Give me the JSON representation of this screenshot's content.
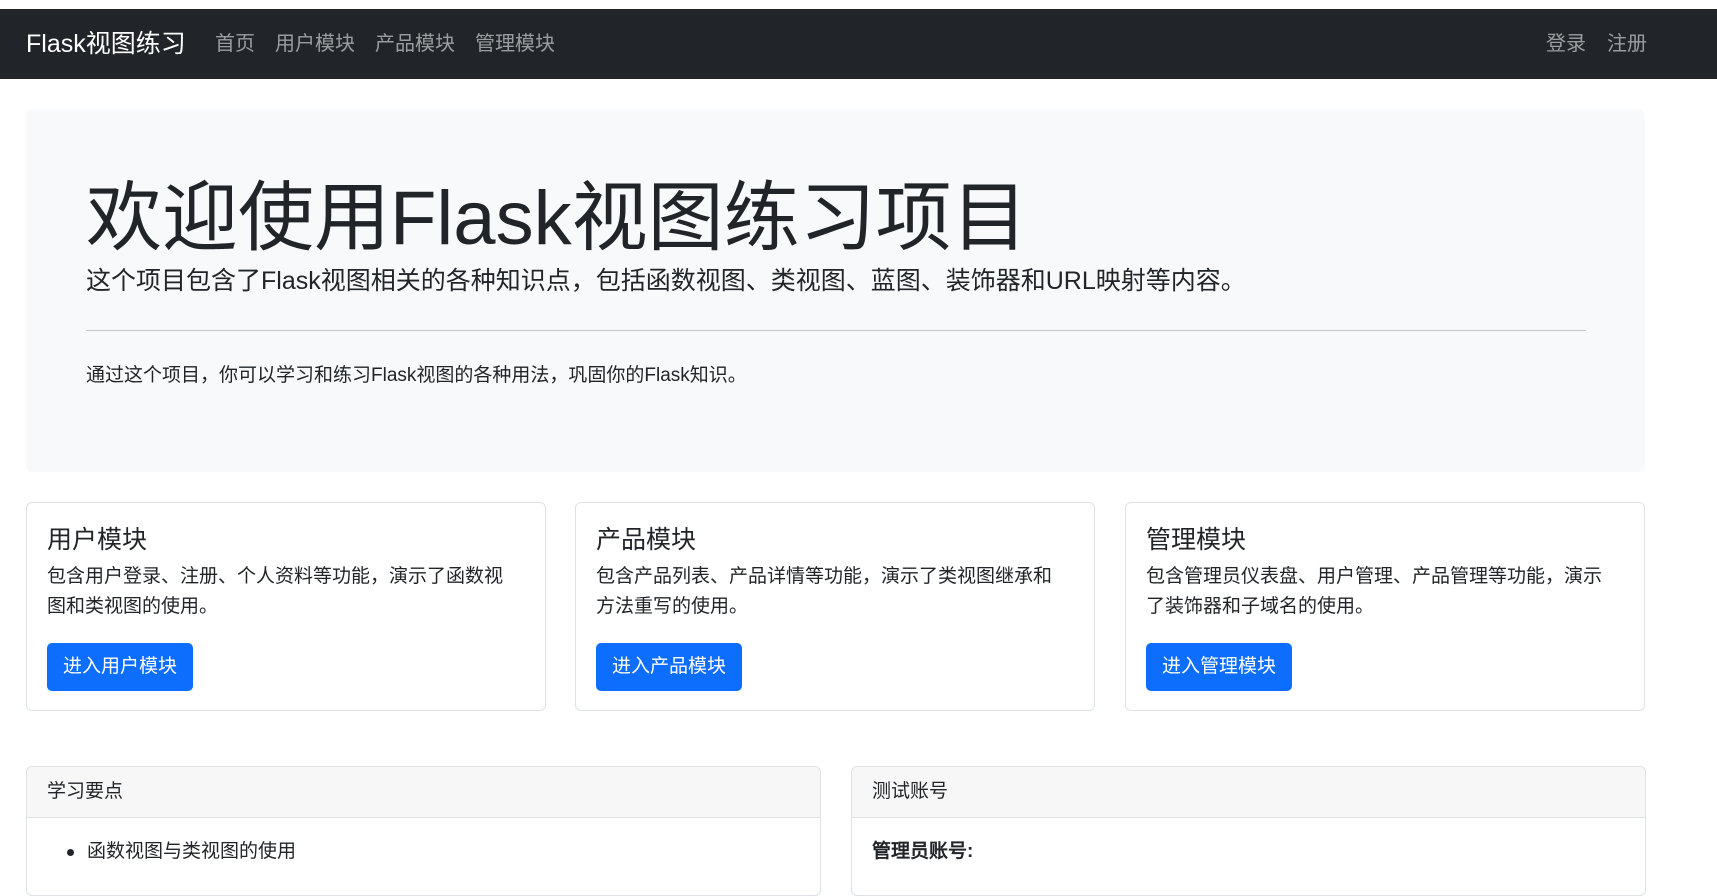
{
  "navbar": {
    "brand": "Flask视图练习",
    "links": [
      "首页",
      "用户模块",
      "产品模块",
      "管理模块"
    ],
    "right_links": [
      "登录",
      "注册"
    ]
  },
  "jumbotron": {
    "title": "欢迎使用Flask视图练习项目",
    "lead": "这个项目包含了Flask视图相关的各种知识点，包括函数视图、类视图、蓝图、装饰器和URL映射等内容。",
    "text": "通过这个项目，你可以学习和练习Flask视图的各种用法，巩固你的Flask知识。"
  },
  "cards": [
    {
      "title": "用户模块",
      "text": "包含用户登录、注册、个人资料等功能，演示了函数视图和类视图的使用。",
      "button": "进入用户模块"
    },
    {
      "title": "产品模块",
      "text": "包含产品列表、产品详情等功能，演示了类视图继承和方法重写的使用。",
      "button": "进入产品模块"
    },
    {
      "title": "管理模块",
      "text": "包含管理员仪表盘、用户管理、产品管理等功能，演示了装饰器和子域名的使用。",
      "button": "进入管理模块"
    }
  ],
  "learning": {
    "header": "学习要点",
    "items": [
      "函数视图与类视图的使用"
    ]
  },
  "accounts": {
    "header": "测试账号",
    "admin_label": "管理员账号:"
  },
  "colors": {
    "navbar_bg": "#212529",
    "primary": "#0d6efd",
    "jumbotron_bg": "#f8f9fa"
  }
}
